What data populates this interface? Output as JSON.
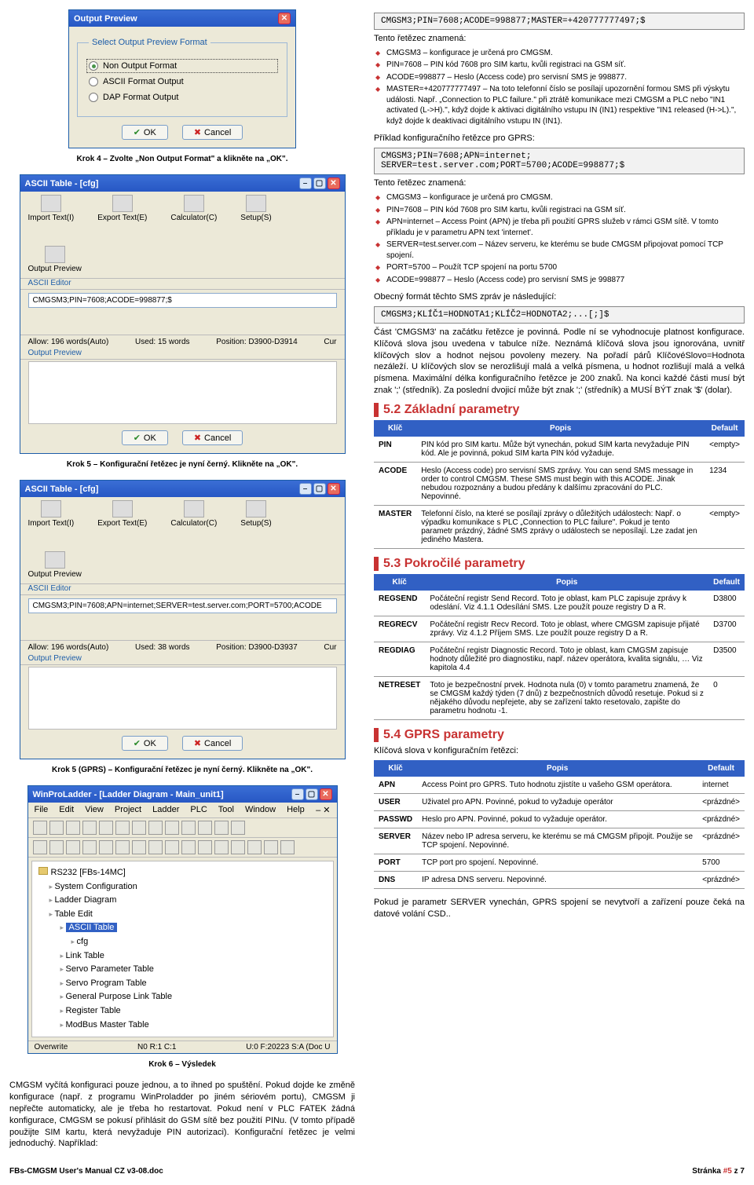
{
  "left": {
    "win1": {
      "title": "Output Preview",
      "legend": "Select Output Preview Format",
      "opts": [
        "Non Output Format",
        "ASCII Format Output",
        "DAP Format Output"
      ],
      "ok": "OK",
      "cancel": "Cancel"
    },
    "step4": "Krok 4 – Zvolte „Non Output Format\" a klikněte na „OK\".",
    "win2": {
      "title": "ASCII Table - [cfg]",
      "tools": [
        "Import Text(I)",
        "Export Text(E)",
        "Calculator(C)",
        "Setup(S)",
        "Output Preview"
      ],
      "sub1": "ASCII Editor",
      "field": "CMGSM3;PIN=7608;ACODE=998877;$",
      "allow": "Allow: 196 words(Auto)",
      "used": "Used: 15 words",
      "pos": "Position: D3900-D3914",
      "cur": "Cur",
      "preview": "Output Preview",
      "ok": "OK",
      "cancel": "Cancel"
    },
    "step5a": "Krok 5 – Konfigurační řetězec je nyní černý. Klikněte na „OK\".",
    "win3": {
      "title": "ASCII Table - [cfg]",
      "field": "CMGSM3;PIN=7608;APN=internet;SERVER=test.server.com;PORT=5700;ACODE",
      "used": "Used: 38 words",
      "pos": "Position: D3900-D3937"
    },
    "step5b": "Krok 5 (GPRS) – Konfigurační řetězec je nyní černý. Klikněte na „OK\".",
    "win4": {
      "title": "WinProLadder - [Ladder Diagram - Main_unit1]",
      "menu": [
        "File",
        "Edit",
        "View",
        "Project",
        "Ladder",
        "PLC",
        "Tool",
        "Window",
        "Help"
      ],
      "menuX": "– ✕",
      "tree_root": "RS232 [FBs-14MC]",
      "tree": [
        "System Configuration",
        "Ladder Diagram",
        "Table Edit"
      ],
      "tree_sub": [
        "ASCII Table",
        "cfg",
        "Link Table",
        "Servo Parameter Table",
        "Servo Program Table",
        "General Purpose Link Table",
        "Register Table",
        "ModBus Master Table"
      ],
      "status1": "Overwrite",
      "status2": "N0 R:1 C:1",
      "status3": "U:0 F:20223 S:A (Doc U"
    },
    "step6": "Krok 6 – Výsledek",
    "bottom": "CMGSM vyčítá konfiguraci pouze jednou, a to ihned po spuštění. Pokud dojde ke změně konfigurace (např. z programu WinProladder po jiném sériovém portu), CMGSM ji nepřečte automaticky, ale je třeba ho restartovat. Pokud není v PLC FATEK žádná konfigurace, CMGSM se pokusí přihlásit do GSM sítě bez použití PINu. (V tomto případě použijte SIM kartu, která nevyžaduje PIN autorizaci). Konfigurační řetězec je velmi jednoduchý. Například:"
  },
  "right": {
    "code1": "CMGSM3;PIN=7608;ACODE=998877;MASTER=+420777777497;$",
    "tento": "Tento řetězec znamená:",
    "b1": [
      "CMGSM3 – konfigurace je určená pro CMGSM.",
      "PIN=7608 – PIN kód 7608 pro SIM kartu, kvůli registraci na GSM síť.",
      "ACODE=998877 – Heslo (Access code) pro servisní SMS je 998877.",
      "MASTER=+420777777497 – Na toto telefonní číslo se posílají upozornění formou SMS při výskytu události. Např. „Connection to PLC failure.\" při ztrátě komunikace mezi CMGSM a PLC nebo \"IN1 activated (L->H).\", když dojde k aktivaci digitálního vstupu IN (IN1) respektive \"IN1 released (H->L).\", když dojde k deaktivaci digitálního vstupu IN (IN1)."
    ],
    "ex2": "Příklad konfiguračního řetězce pro GPRS:",
    "code2": "CMGSM3;PIN=7608;APN=internet;\nSERVER=test.server.com;PORT=5700;ACODE=998877;$",
    "b2": [
      "CMGSM3 – konfigurace je určená pro CMGSM.",
      "PIN=7608 – PIN kód 7608 pro SIM kartu, kvůli registraci na GSM síť.",
      "APN=internet – Access Point (APN) je třeba při použití GPRS služeb v rámci GSM sítě. V tomto příkladu je v parametru APN text 'internet'.",
      "SERVER=test.server.com – Název serveru, ke kterému se bude CMGSM připojovat pomocí TCP spojení.",
      "PORT=5700 – Použít TCP spojení na portu 5700",
      "ACODE=998877 – Heslo (Access code) pro servisní SMS je 998877"
    ],
    "gen": "Obecný formát těchto SMS zpráv je následující:",
    "code3": "CMGSM3;KLÍČ1=HODNOTA1;KLÍČ2=HODNOTA2;...[;]$",
    "genpara": "Část 'CMGSM3' na začátku řetězce je povinná. Podle ní se vyhodnocuje platnost konfigurace. Klíčová slova jsou uvedena v tabulce níže. Neznámá klíčová slova jsou ignorována, uvnitř klíčových slov a hodnot nejsou povoleny mezery. Na pořadí párů KlíčovéSlovo=Hodnota nezáleží. U klíčových slov se nerozlišují malá a velká písmena, u hodnot rozlišují malá a velká písmena. Maximální délka konfiguračního řetězce je 200 znaků. Na konci každé části musí být znak ';' (středník). Za poslední dvojicí může být znak ';' (středník) a MUSÍ BÝT znak '$' (dolar).",
    "h52": "5.2 Základní parametry",
    "t52": {
      "hdr": [
        "Klíč",
        "Popis",
        "Default"
      ],
      "rows": [
        [
          "PIN",
          "PIN kód pro SIM kartu. Může být vynechán, pokud SIM karta nevyžaduje PIN kód. Ale je povinná, pokud SIM karta PIN kód vyžaduje.",
          "<empty>"
        ],
        [
          "ACODE",
          "Heslo (Access code) pro servisní SMS zprávy. You can send SMS message in order to control CMGSM. These SMS must begin with this ACODE. Jinak nebudou rozpoznány a budou předány k dalšímu zpracování do PLC. Nepovinné.",
          "1234"
        ],
        [
          "MASTER",
          "Telefonní číslo, na které se posílají zprávy o důležitých událostech: Např. o výpadku komunikace s PLC „Connection to PLC failure\". Pokud je tento parametr prázdný, žádné SMS zprávy o událostech se neposílají. Lze zadat jen jediného Mastera.",
          "<empty>"
        ]
      ]
    },
    "h53": "5.3 Pokročilé parametry",
    "t53": {
      "rows": [
        [
          "REGSEND",
          "Počáteční registr Send Record. Toto je oblast, kam PLC zapisuje zprávy k odeslání. Viz 4.1.1 Odesílání SMS. Lze použít pouze registry D a R.",
          "D3800"
        ],
        [
          "REGRECV",
          "Počáteční registr Recv Record. Toto je oblast, where CMGSM zapisuje přijaté zprávy. Viz 4.1.2 Příjem SMS. Lze použít pouze registry D a R.",
          "D3700"
        ],
        [
          "REGDIAG",
          "Počáteční registr Diagnostic Record. Toto je oblast, kam CMGSM zapisuje hodnoty důležité pro diagnostiku, např. název operátora, kvalita signálu, … Viz kapitola 4.4",
          "D3500"
        ],
        [
          "NETRESET",
          "Toto je bezpečnostní prvek. Hodnota nula (0) v tomto parametru znamená, že se CMGSM každý týden (7 dnů) z bezpečnostních důvodů resetuje. Pokud si z nějakého důvodu nepřejete, aby se zařízení takto resetovalo, zapište do parametru hodnotu -1.",
          "0"
        ]
      ]
    },
    "h54": "5.4 GPRS parametry",
    "h54sub": "Klíčová slova v konfiguračním řetězci:",
    "t54": {
      "rows": [
        [
          "APN",
          "Access Point pro GPRS.\nTuto hodnotu zjistíte u vašeho GSM operátora.",
          "internet"
        ],
        [
          "USER",
          "Uživatel pro APN. Povinné, pokud to vyžaduje operátor",
          "<prázdné>"
        ],
        [
          "PASSWD",
          "Heslo pro APN. Povinné, pokud to vyžaduje operátor.",
          "<prázdné>"
        ],
        [
          "SERVER",
          "Název nebo IP adresa serveru, ke kterému se má CMGSM připojit. Použije se TCP spojení. Nepovinné.",
          "<prázdné>"
        ],
        [
          "PORT",
          "TCP port pro spojení. Nepovinné.",
          "5700"
        ],
        [
          "DNS",
          "IP adresa DNS serveru. Nepovinné.",
          "<prázdné>"
        ]
      ]
    },
    "end": "Pokud je parametr SERVER vynechán,  GPRS spojení se nevytvoří a zařízení pouze čeká na datové volání CSD.."
  },
  "footer": {
    "left": "FBs-CMGSM User's Manual CZ v3-08.doc",
    "right_a": "Stránka ",
    "right_b": "#5",
    "right_c": " z 7"
  }
}
